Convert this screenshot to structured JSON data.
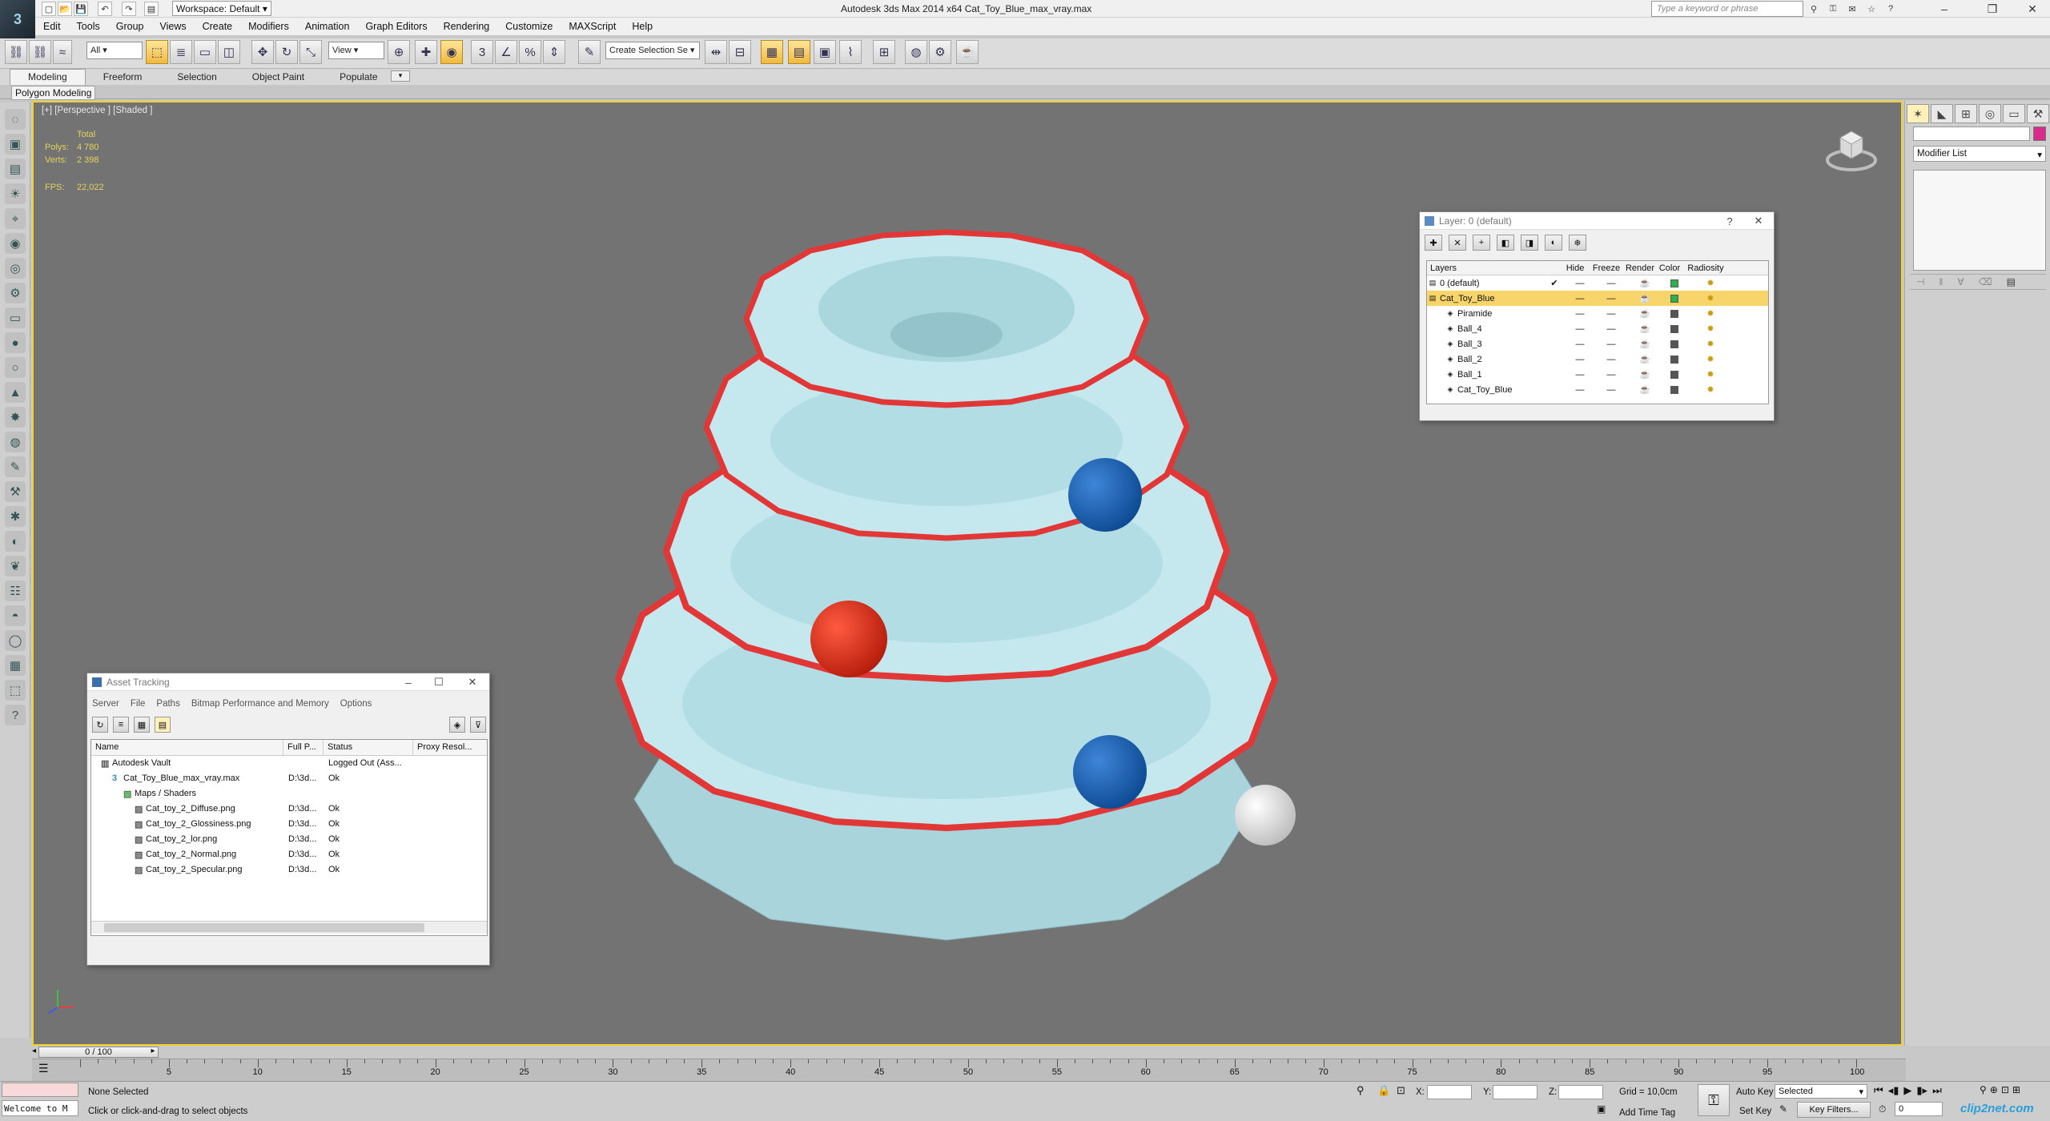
{
  "app": {
    "title": "Autodesk 3ds Max  2014 x64     Cat_Toy_Blue_max_vray.max",
    "logo": "3",
    "workspace": "Workspace: Default",
    "search_placeholder": "Type a keyword or phrase"
  },
  "menu": [
    "Edit",
    "Tools",
    "Group",
    "Views",
    "Create",
    "Modifiers",
    "Animation",
    "Graph Editors",
    "Rendering",
    "Customize",
    "MAXScript",
    "Help"
  ],
  "toolbar": {
    "filter": "All",
    "refcoord": "View",
    "selection_set": "Create Selection Se"
  },
  "ribbon": {
    "tabs": [
      "Modeling",
      "Freeform",
      "Selection",
      "Object Paint",
      "Populate"
    ],
    "active": "Modeling",
    "sub": "Polygon Modeling"
  },
  "viewport": {
    "label": "[+] [Perspective ] [Shaded ]",
    "stats": {
      "total_label": "Total",
      "polys_label": "Polys:",
      "polys": "4 780",
      "verts_label": "Verts:",
      "verts": "2 398",
      "fps_label": "FPS:",
      "fps": "22,022"
    },
    "colors": {
      "toy": "#bde6ee",
      "rim": "#e03a3a",
      "ball_blue": "#1560b8",
      "ball_red": "#e03218",
      "ball_white": "#eeeeee"
    }
  },
  "layer_manager": {
    "title": "Layer: 0 (default)",
    "headers": [
      "Layers",
      "Hide",
      "Freeze",
      "Render",
      "Color",
      "Radiosity"
    ],
    "rows": [
      {
        "name": "0 (default)",
        "color": "#2db24a",
        "current": true
      },
      {
        "name": "Cat_Toy_Blue",
        "color": "#2db24a",
        "selected": true
      },
      {
        "name": "Piramide",
        "color": "#555555"
      },
      {
        "name": "Ball_4",
        "color": "#555555"
      },
      {
        "name": "Ball_3",
        "color": "#555555"
      },
      {
        "name": "Ball_2",
        "color": "#555555"
      },
      {
        "name": "Ball_1",
        "color": "#555555"
      },
      {
        "name": "Cat_Toy_Blue",
        "color": "#555555"
      }
    ]
  },
  "asset_tracking": {
    "title": "Asset Tracking",
    "menu": [
      "Server",
      "File",
      "Paths",
      "Bitmap Performance and Memory",
      "Options"
    ],
    "headers": [
      "Name",
      "Full P...",
      "Status",
      "Proxy Resol..."
    ],
    "rows": [
      {
        "name": "Autodesk Vault",
        "path": "",
        "status": "Logged Out (Ass...",
        "indent": 1
      },
      {
        "name": "Cat_Toy_Blue_max_vray.max",
        "path": "D:\\3d...",
        "status": "Ok",
        "indent": 2
      },
      {
        "name": "Maps / Shaders",
        "path": "",
        "status": "",
        "indent": 3
      },
      {
        "name": "Cat_toy_2_Diffuse.png",
        "path": "D:\\3d...",
        "status": "Ok",
        "indent": 4
      },
      {
        "name": "Cat_toy_2_Glossiness.png",
        "path": "D:\\3d...",
        "status": "Ok",
        "indent": 4
      },
      {
        "name": "Cat_toy_2_lor.png",
        "path": "D:\\3d...",
        "status": "Ok",
        "indent": 4
      },
      {
        "name": "Cat_toy_2_Normal.png",
        "path": "D:\\3d...",
        "status": "Ok",
        "indent": 4
      },
      {
        "name": "Cat_toy_2_Specular.png",
        "path": "D:\\3d...",
        "status": "Ok",
        "indent": 4
      }
    ]
  },
  "command_panel": {
    "modifier_list": "Modifier List",
    "swatch_color": "#d82c8d"
  },
  "time": {
    "slider": "0 / 100",
    "ticks": [
      "5",
      "10",
      "15",
      "20",
      "25",
      "30",
      "35",
      "40",
      "45",
      "50",
      "55",
      "60",
      "65",
      "70",
      "75",
      "80",
      "85",
      "90",
      "95",
      "100"
    ]
  },
  "status": {
    "welcome": "Welcome to M",
    "selection": "None Selected",
    "prompt": "Click or click-and-drag to select objects",
    "x_label": "X:",
    "y_label": "Y:",
    "z_label": "Z:",
    "grid": "Grid = 10,0cm",
    "add_time_tag": "Add Time Tag",
    "auto_key": "Auto Key",
    "set_key": "Set Key",
    "selected": "Selected",
    "key_filters": "Key Filters...",
    "frame": "0",
    "watermark": "clip2net.com"
  }
}
